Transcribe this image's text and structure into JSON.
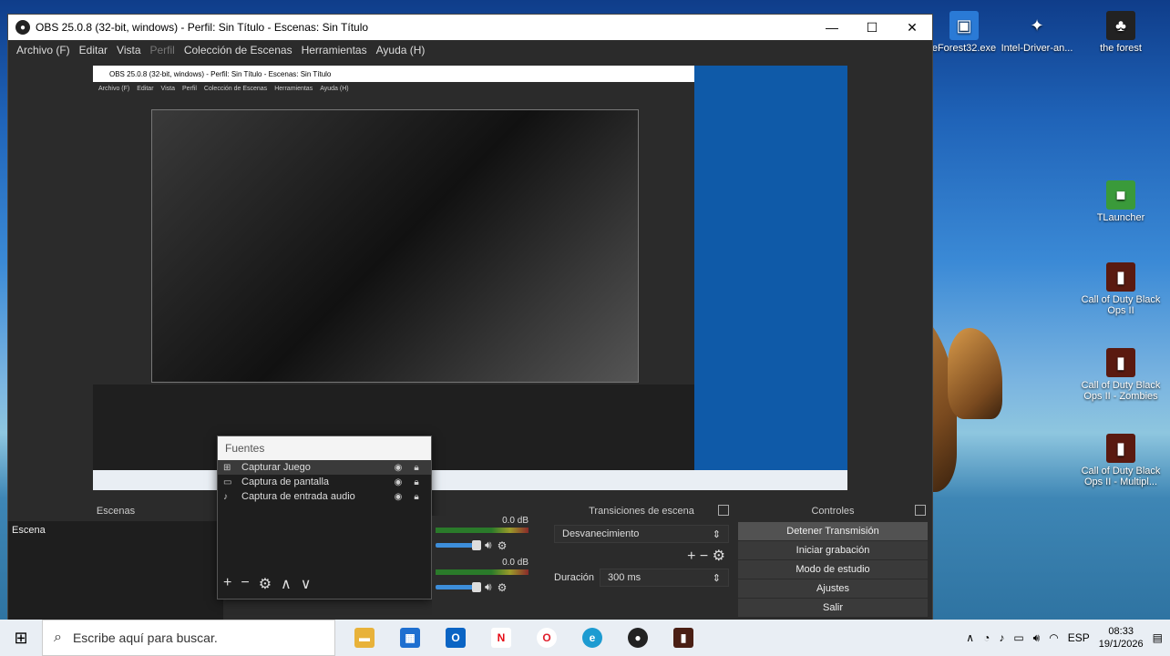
{
  "window": {
    "title": "OBS 25.0.8 (32-bit, windows) - Perfil: Sin Título - Escenas: Sin Título",
    "minimize_glyph": "—",
    "maximize_glyph": "☐",
    "close_glyph": "✕"
  },
  "menu": {
    "items": [
      "Archivo (F)",
      "Editar",
      "Vista",
      "Perfil",
      "Colección de Escenas",
      "Herramientas",
      "Ayuda (H)"
    ]
  },
  "preview": {
    "nested_title": "OBS 25.0.8 (32-bit, windows) - Perfil: Sin Título - Escenas: Sin Título",
    "nested_menu": [
      "Archivo (F)",
      "Editar",
      "Vista",
      "Perfil",
      "Colección de Escenas",
      "Herramientas",
      "Ayuda (H)"
    ]
  },
  "sources": {
    "header": "Fuentes",
    "items": [
      {
        "icon": "gamepad-icon",
        "label": "Capturar Juego"
      },
      {
        "icon": "monitor-icon",
        "label": "Captura de pantalla"
      },
      {
        "icon": "microphone-icon",
        "label": "Captura de entrada audio"
      }
    ]
  },
  "scenes": {
    "header": "Escenas",
    "items": [
      "Escena"
    ]
  },
  "mixer": {
    "channels": [
      {
        "db": "0.0 dB"
      },
      {
        "db": "0.0 dB"
      }
    ]
  },
  "transitions": {
    "header": "Transiciones de escena",
    "selected": "Desvanecimiento",
    "duration_label": "Duración",
    "duration_value": "300 ms"
  },
  "controls": {
    "header": "Controles",
    "buttons": [
      "Detener Transmisión",
      "Iniciar grabación",
      "Modo de estudio",
      "Ajustes",
      "Salir"
    ]
  },
  "desktop": {
    "icons": [
      {
        "label": "eForest32.exe"
      },
      {
        "label": "Intel-Driver-an..."
      },
      {
        "label": "the forest"
      },
      {
        "label": "TLauncher"
      },
      {
        "label": "Call of Duty Black Ops II"
      },
      {
        "label": "Call of Duty Black Ops II - Zombies"
      },
      {
        "label": "Call of Duty Black Ops II - Multipl..."
      }
    ]
  },
  "taskbar": {
    "search_placeholder": "Escribe aquí para buscar.",
    "language": "ESP",
    "time": "08:33",
    "date": "19/1/2026"
  },
  "colors": {
    "obs_dark": "#2b2b2b",
    "panel": "#1e1e1e",
    "accent_slider": "#3d8eda"
  }
}
